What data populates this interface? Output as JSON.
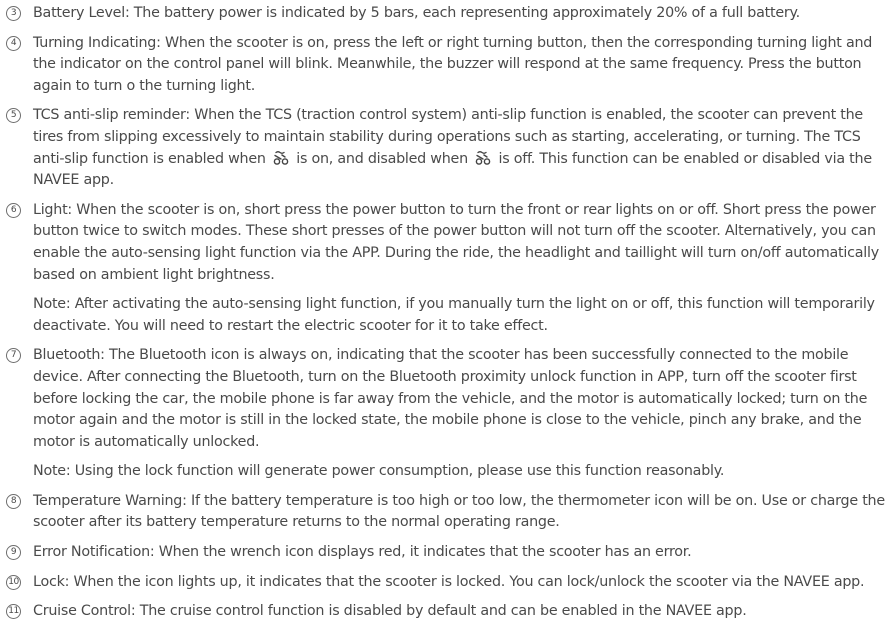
{
  "items": {
    "i3": {
      "num": "3",
      "text": "Battery Level: The battery power is indicated by 5 bars, each representing approximately 20% of a full battery."
    },
    "i4": {
      "num": "4",
      "text": "Turning Indicating: When the scooter is on, press the left or right turning button, then the corresponding turning light and the indicator on the control panel will blink. Meanwhile, the buzzer will respond at the same frequency. Press the button again to turn o the turning light."
    },
    "i5": {
      "num": "5",
      "part1": "TCS anti-slip reminder: When the TCS (traction control system) anti-slip function is enabled, the scooter can prevent the tires from slipping excessively to maintain stability during operations such as starting, accelerating, or turning. The TCS anti-slip function is enabled when",
      "part2": "is on, and disabled when",
      "part3": "is off. This function can be enabled or disabled via the NAVEE app.",
      "icon": "tcs-icon"
    },
    "i6": {
      "num": "6",
      "text": "Light: When the scooter is on, short press the power button to turn the front or rear lights on or off. Short press the power button twice to switch modes. These short presses of the power button will not turn off the scooter. Alternatively, you  can enable the auto-sensing light function via the APP. During the ride, the headlight and taillight will turn on/off automatically based on ambient light brightness."
    },
    "note6": "Note: After activating the auto-sensing light function, if you manually turn the light on or off, this function will temporarily deactivate. You will need to restart the electric scooter for it to take effect.",
    "i7": {
      "num": "7",
      "text": "Bluetooth: The Bluetooth icon is always on, indicating that the scooter has been successfully connected to the mobile device. After connecting the Bluetooth, turn on the Bluetooth proximity unlock function in APP, turn off the scooter first before locking the car, the mobile phone is far away from the vehicle, and the motor is automatically locked; turn on the motor again and the motor is still in the locked state, the mobile phone is close to the vehicle, pinch any brake, and the motor is automatically unlocked."
    },
    "note7": "Note: Using the lock function will generate power consumption, please use this function reasonably.",
    "i8": {
      "num": "8",
      "text": "Temperature Warning: If the battery temperature is too high or too low, the thermometer icon will be on. Use or charge the scooter after its battery temperature returns to the normal operating range."
    },
    "i9": {
      "num": "9",
      "text": "Error Notification: When the wrench icon displays red, it indicates that the scooter has an error."
    },
    "i10": {
      "num": "10",
      "text": "Lock: When the icon lights up, it indicates that the scooter is locked. You can lock/unlock the scooter via the NAVEE app."
    },
    "i11": {
      "num": "11",
      "text": "Cruise Control: The cruise control function is disabled by default and can be enabled in the NAVEE app."
    }
  },
  "colors": {
    "text": "#4a4a4a",
    "icon": "#444444"
  }
}
